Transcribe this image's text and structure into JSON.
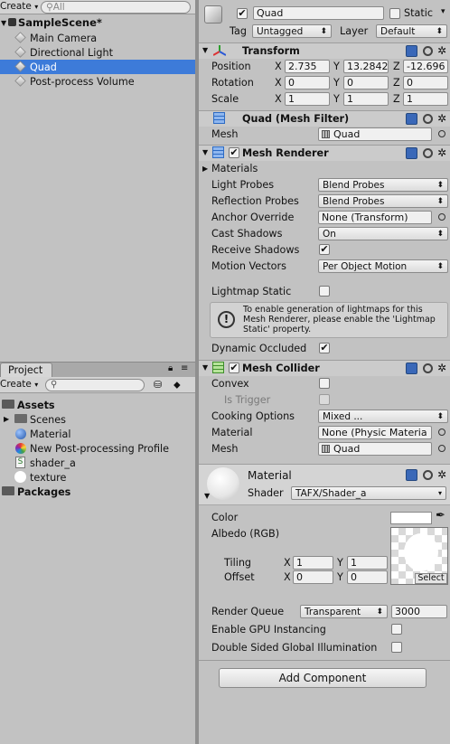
{
  "hierarchy": {
    "create_label": "Create",
    "search_placeholder": "All",
    "scene": "SampleScene*",
    "items": [
      "Main Camera",
      "Directional Light",
      "Quad",
      "Post-process Volume"
    ]
  },
  "project": {
    "tab": "Project",
    "create_label": "Create",
    "tree": {
      "assets": "Assets",
      "scenes": "Scenes",
      "material": "Material",
      "profile": "New Post-processing Profile",
      "shader": "shader_a",
      "texture": "texture",
      "packages": "Packages"
    }
  },
  "inspector": {
    "object": {
      "name": "Quad",
      "static_label": "Static",
      "tag_label": "Tag",
      "tag_value": "Untagged",
      "layer_label": "Layer",
      "layer_value": "Default"
    },
    "transform": {
      "title": "Transform",
      "position_label": "Position",
      "rotation_label": "Rotation",
      "scale_label": "Scale",
      "position": {
        "x": "2.735",
        "y": "13.2842",
        "z": "-12.696"
      },
      "rotation": {
        "x": "0",
        "y": "0",
        "z": "0"
      },
      "scale": {
        "x": "1",
        "y": "1",
        "z": "1"
      }
    },
    "mesh_filter": {
      "title": "Quad (Mesh Filter)",
      "mesh_label": "Mesh",
      "mesh_value": "Quad"
    },
    "mesh_renderer": {
      "title": "Mesh Renderer",
      "materials": "Materials",
      "light_probes_label": "Light Probes",
      "light_probes": "Blend Probes",
      "reflection_probes_label": "Reflection Probes",
      "reflection_probes": "Blend Probes",
      "anchor_label": "Anchor Override",
      "anchor": "None (Transform)",
      "cast_label": "Cast Shadows",
      "cast": "On",
      "receive_label": "Receive Shadows",
      "motion_label": "Motion Vectors",
      "motion": "Per Object Motion",
      "lightmap_label": "Lightmap Static",
      "info": [
        "To enable generation of lightmaps for this",
        "Mesh Renderer, please enable the 'Lightmap",
        "Static' property."
      ],
      "occluded_label": "Dynamic Occluded"
    },
    "mesh_collider": {
      "title": "Mesh Collider",
      "convex_label": "Convex",
      "trigger_label": "Is Trigger",
      "cooking_label": "Cooking Options",
      "cooking": "Mixed ...",
      "material_label": "Material",
      "material": "None (Physic Materia",
      "mesh_label": "Mesh",
      "mesh": "Quad"
    },
    "material": {
      "title": "Material",
      "shader_label": "Shader",
      "shader": "TAFX/Shader_a",
      "color_label": "Color",
      "albedo_label": "Albedo (RGB)",
      "tiling_label": "Tiling",
      "offset_label": "Offset",
      "tiling": {
        "x": "1",
        "y": "1"
      },
      "offset": {
        "x": "0",
        "y": "0"
      },
      "select_label": "Select",
      "queue_label": "Render Queue",
      "queue_mode": "Transparent",
      "queue_value": "3000",
      "gpu_label": "Enable GPU Instancing",
      "dsgi_label": "Double Sided Global Illumination"
    },
    "add_component": "Add Component",
    "axis": {
      "x": "X",
      "y": "Y",
      "z": "Z"
    }
  }
}
